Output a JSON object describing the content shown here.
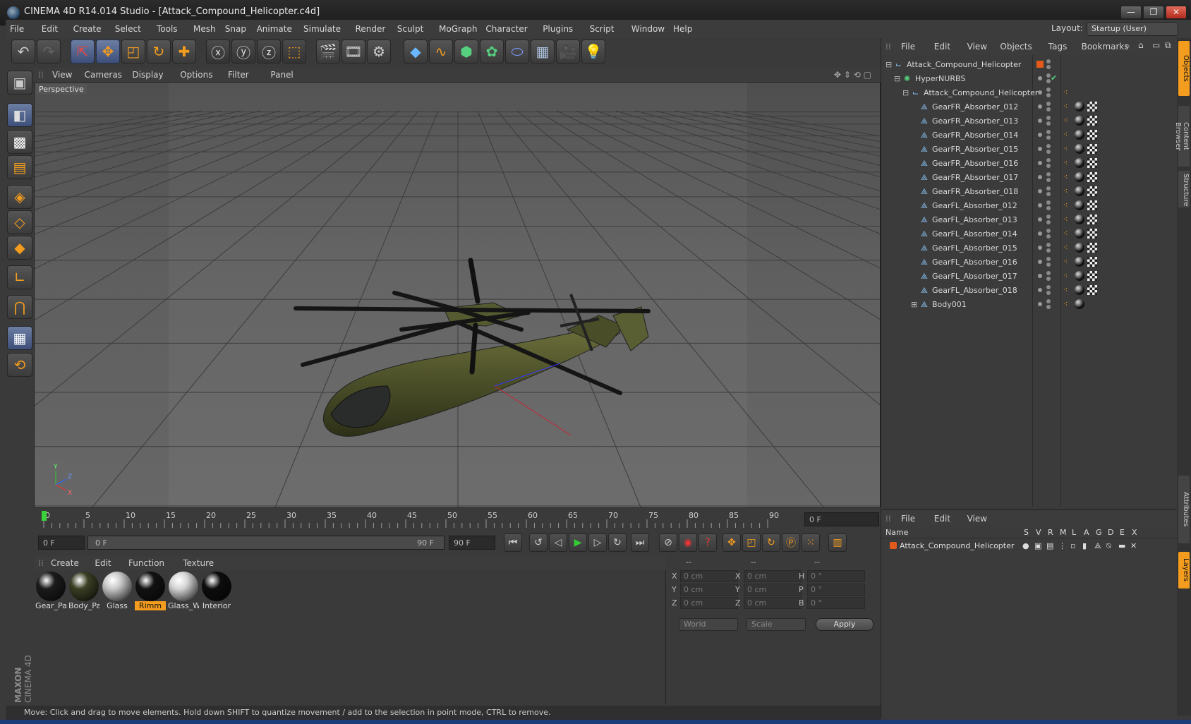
{
  "window": {
    "title": "CINEMA 4D R14.014 Studio - [Attack_Compound_Helicopter.c4d]",
    "min": "—",
    "max": "❐",
    "close": "✕"
  },
  "menubar": {
    "items": [
      "File",
      "Edit",
      "Create",
      "Select",
      "Tools",
      "Mesh",
      "Snap",
      "Animate",
      "Simulate",
      "Render",
      "Sculpt",
      "MoGraph",
      "Character",
      "Plugins",
      "Script",
      "Window",
      "Help"
    ],
    "layout_label": "Layout:",
    "layout_value": "Startup (User)"
  },
  "viewport": {
    "menu": [
      "View",
      "Cameras",
      "Display",
      "Options",
      "Filter",
      "Panel"
    ],
    "label": "Perspective",
    "axis_y": "Y",
    "axis_z": "Z",
    "axis_x": "X"
  },
  "timeline": {
    "ticks": [
      "0",
      "5",
      "10",
      "15",
      "20",
      "25",
      "30",
      "35",
      "40",
      "45",
      "50",
      "55",
      "60",
      "65",
      "70",
      "75",
      "80",
      "85",
      "90"
    ],
    "current_frame_display": "0 F"
  },
  "transport": {
    "start_field": "0 F",
    "range_left": "0 F",
    "range_right": "90 F",
    "end_field": "90 F"
  },
  "materials": {
    "menu": [
      "Create",
      "Edit",
      "Function",
      "Texture"
    ],
    "items": [
      {
        "name": "Gear_Pa",
        "color": "#1b1b1b"
      },
      {
        "name": "Body_Pa",
        "color": "#3b3f24"
      },
      {
        "name": "Glass",
        "color": "#c9c9c9"
      },
      {
        "name": "Rimm",
        "color": "#111111"
      },
      {
        "name": "Glass_W",
        "color": "#d6d6d6"
      },
      {
        "name": "Interior",
        "color": "#0c0c0c"
      }
    ]
  },
  "coords": {
    "header": [
      "--",
      "--",
      "--"
    ],
    "rows": [
      {
        "l1": "X",
        "v1": "0 cm",
        "l2": "X",
        "v2": "0 cm",
        "l3": "H",
        "v3": "0 °"
      },
      {
        "l1": "Y",
        "v1": "0 cm",
        "l2": "Y",
        "v2": "0 cm",
        "l3": "P",
        "v3": "0 °"
      },
      {
        "l1": "Z",
        "v1": "0 cm",
        "l2": "Z",
        "v2": "0 cm",
        "l3": "B",
        "v3": "0 °"
      }
    ],
    "mode1": "World",
    "mode2": "Scale",
    "apply": "Apply"
  },
  "status": "Move: Click and drag to move elements. Hold down SHIFT to quantize movement / add to the selection in point mode, CTRL to remove.",
  "objects": {
    "menu": [
      "File",
      "Edit",
      "View",
      "Objects",
      "Tags",
      "Bookmarks"
    ],
    "rows": [
      {
        "name": "Attack_Compound_Helicopter",
        "indent": 0,
        "kind": "null"
      },
      {
        "name": "HyperNURBS",
        "indent": 1,
        "kind": "nurbs"
      },
      {
        "name": "Attack_Compound_Helicopter",
        "indent": 2,
        "kind": "null"
      },
      {
        "name": "GearFR_Absorber_012",
        "indent": 3,
        "kind": "mesh"
      },
      {
        "name": "GearFR_Absorber_013",
        "indent": 3,
        "kind": "mesh"
      },
      {
        "name": "GearFR_Absorber_014",
        "indent": 3,
        "kind": "mesh"
      },
      {
        "name": "GearFR_Absorber_015",
        "indent": 3,
        "kind": "mesh"
      },
      {
        "name": "GearFR_Absorber_016",
        "indent": 3,
        "kind": "mesh"
      },
      {
        "name": "GearFR_Absorber_017",
        "indent": 3,
        "kind": "mesh"
      },
      {
        "name": "GearFR_Absorber_018",
        "indent": 3,
        "kind": "mesh"
      },
      {
        "name": "GearFL_Absorber_012",
        "indent": 3,
        "kind": "mesh"
      },
      {
        "name": "GearFL_Absorber_013",
        "indent": 3,
        "kind": "mesh"
      },
      {
        "name": "GearFL_Absorber_014",
        "indent": 3,
        "kind": "mesh"
      },
      {
        "name": "GearFL_Absorber_015",
        "indent": 3,
        "kind": "mesh"
      },
      {
        "name": "GearFL_Absorber_016",
        "indent": 3,
        "kind": "mesh"
      },
      {
        "name": "GearFL_Absorber_017",
        "indent": 3,
        "kind": "mesh"
      },
      {
        "name": "GearFL_Absorber_018",
        "indent": 3,
        "kind": "mesh"
      },
      {
        "name": "Body001",
        "indent": 3,
        "kind": "mesh"
      }
    ]
  },
  "layers": {
    "menu": [
      "File",
      "Edit",
      "View"
    ],
    "col_name": "Name",
    "cols": [
      "S",
      "V",
      "R",
      "M",
      "L",
      "A",
      "G",
      "D",
      "E",
      "X"
    ],
    "row": "Attack_Compound_Helicopter"
  },
  "side_tabs": [
    "Objects",
    "Content Browser",
    "Structure",
    "Attributes",
    "Layers"
  ],
  "colors": {
    "accent": "#f39c1e",
    "active_tool": "#4d5f8d"
  }
}
